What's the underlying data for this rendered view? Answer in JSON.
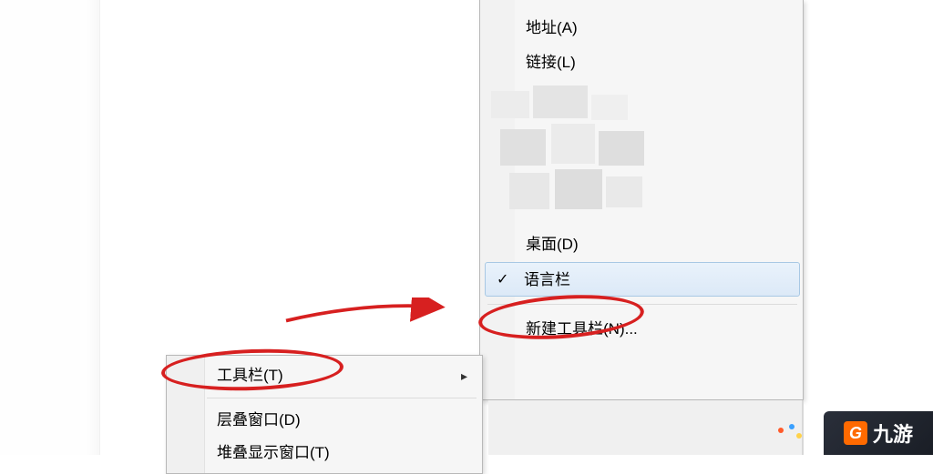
{
  "context_menu": {
    "toolbar": {
      "label": "工具栏(T)"
    },
    "cascade": {
      "label": "层叠窗口(D)"
    },
    "stack": {
      "label": "堆叠显示窗口(T)"
    }
  },
  "submenu": {
    "address": {
      "label": "地址(A)"
    },
    "links": {
      "label": "链接(L)"
    },
    "desktop": {
      "label": "桌面(D)"
    },
    "language_bar": {
      "label": "语言栏",
      "checked": true
    },
    "new_toolbar": {
      "label": "新建工具栏(N)..."
    }
  },
  "watermark": {
    "text": "九游"
  },
  "annotations": {
    "arrow_color": "#d72020",
    "ellipse_color": "#d72020"
  }
}
